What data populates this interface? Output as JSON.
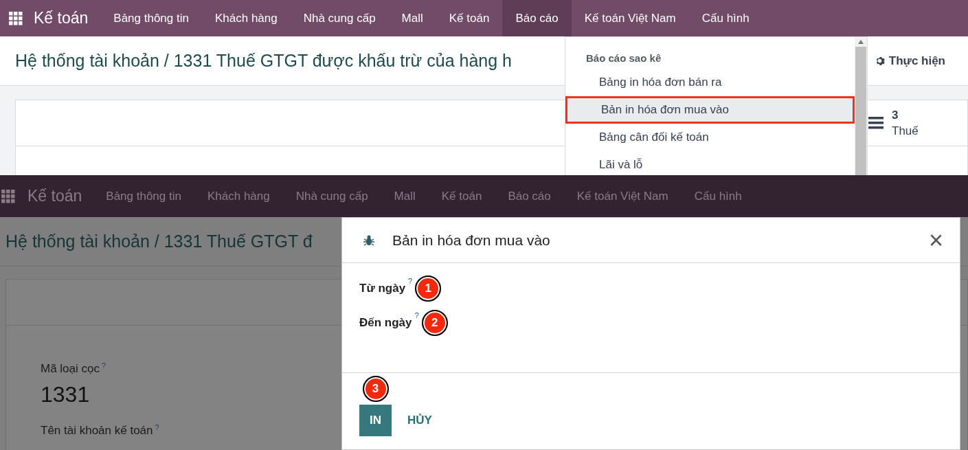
{
  "top_panel": {
    "navbar": {
      "brand": "Kế toán",
      "items": [
        {
          "label": "Bảng thông tin",
          "selected": false
        },
        {
          "label": "Khách hàng",
          "selected": false
        },
        {
          "label": "Nhà cung cấp",
          "selected": false
        },
        {
          "label": "Mall",
          "selected": false
        },
        {
          "label": "Kế toán",
          "selected": false
        },
        {
          "label": "Báo cáo",
          "selected": true
        },
        {
          "label": "Kế toán Việt Nam",
          "selected": false
        },
        {
          "label": "Cấu hình",
          "selected": false
        }
      ]
    },
    "breadcrumb": "Hệ thống tài khoản / 1331 Thuế GTGT được khấu trừ của hàng h",
    "action_button": "Thực hiện",
    "stat_button": {
      "value": "3",
      "label": "Thuế"
    },
    "dropdown": {
      "section": "Báo cáo sao kê",
      "items": [
        {
          "label": "Bảng in hóa đơn bán ra",
          "selected": false
        },
        {
          "label": "Bản in hóa đơn mua vào",
          "selected": true
        },
        {
          "label": "Bảng cân đối kế toán",
          "selected": false
        },
        {
          "label": "Lãi và lỗ",
          "selected": false
        }
      ]
    }
  },
  "bottom_panel": {
    "navbar": {
      "brand": "Kế toán",
      "items": [
        "Bảng thông tin",
        "Khách hàng",
        "Nhà cung cấp",
        "Mall",
        "Kế toán",
        "Báo cáo",
        "Kế toán Việt Nam",
        "Cấu hình"
      ]
    },
    "breadcrumb": "Hệ thống tài khoản / 1331 Thuế GTGT đ",
    "fields": [
      {
        "label": "Mã loại cọc",
        "help": "?",
        "value": "1331"
      },
      {
        "label": "Tên tài khoản kế toán",
        "help": "?"
      }
    ],
    "dialog": {
      "title": "Bản in hóa đơn mua vào",
      "close": "×",
      "fields": [
        {
          "label": "Từ ngày",
          "help": "?",
          "marker": "1"
        },
        {
          "label": "Đến ngày",
          "help": "?",
          "marker": "2"
        }
      ],
      "buttons": [
        {
          "label": "IN",
          "kind": "primary",
          "marker": "3"
        },
        {
          "label": "HỦY",
          "kind": "secondary"
        }
      ]
    }
  }
}
